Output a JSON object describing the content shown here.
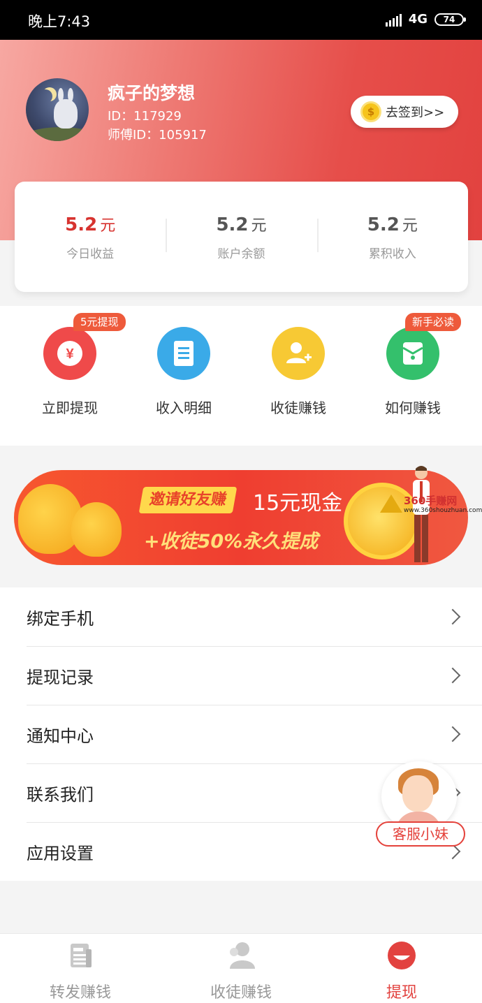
{
  "status_bar": {
    "time": "晚上7:43",
    "network": "4G",
    "battery": "74"
  },
  "profile": {
    "name": "疯子的梦想",
    "id_text": "ID：117929",
    "master_id_text": "师傅ID：105917",
    "signin_label": "去签到>>"
  },
  "earnings": [
    {
      "value": "5.2",
      "unit": "元",
      "label": "今日收益"
    },
    {
      "value": "5.2",
      "unit": "元",
      "label": "账户余额"
    },
    {
      "value": "5.2",
      "unit": "元",
      "label": "累积收入"
    }
  ],
  "actions": [
    {
      "label": "立即提现",
      "badge": "5元提现",
      "icon": "yuan-icon",
      "color": "#ef4a4a"
    },
    {
      "label": "收入明细",
      "badge": "",
      "icon": "document-icon",
      "color": "#3aaae8"
    },
    {
      "label": "收徒赚钱",
      "badge": "",
      "icon": "add-user-icon",
      "color": "#f7c934"
    },
    {
      "label": "如何赚钱",
      "badge": "新手必读",
      "icon": "envelope-icon",
      "color": "#34c06c"
    }
  ],
  "banner": {
    "highlight": "邀请好友赚",
    "title_rest": "15元现金",
    "subtitle": "+收徒50%永久提成"
  },
  "watermark": {
    "main": "360手赚网",
    "sub": "www.360shouzhuan.com"
  },
  "menu": [
    {
      "label": "绑定手机"
    },
    {
      "label": "提现记录"
    },
    {
      "label": "通知中心"
    },
    {
      "label": "联系我们"
    },
    {
      "label": "应用设置"
    }
  ],
  "customer_service": {
    "label": "客服小妹"
  },
  "bottom_nav": [
    {
      "label": "转发赚钱",
      "icon": "news-icon",
      "active": false
    },
    {
      "label": "收徒赚钱",
      "icon": "user-icon",
      "active": false
    },
    {
      "label": "提现",
      "icon": "withdraw-icon",
      "active": true
    }
  ],
  "colors": {
    "accent": "#e2423f",
    "header_start": "#f7a8a2",
    "header_end": "#e2423f"
  }
}
